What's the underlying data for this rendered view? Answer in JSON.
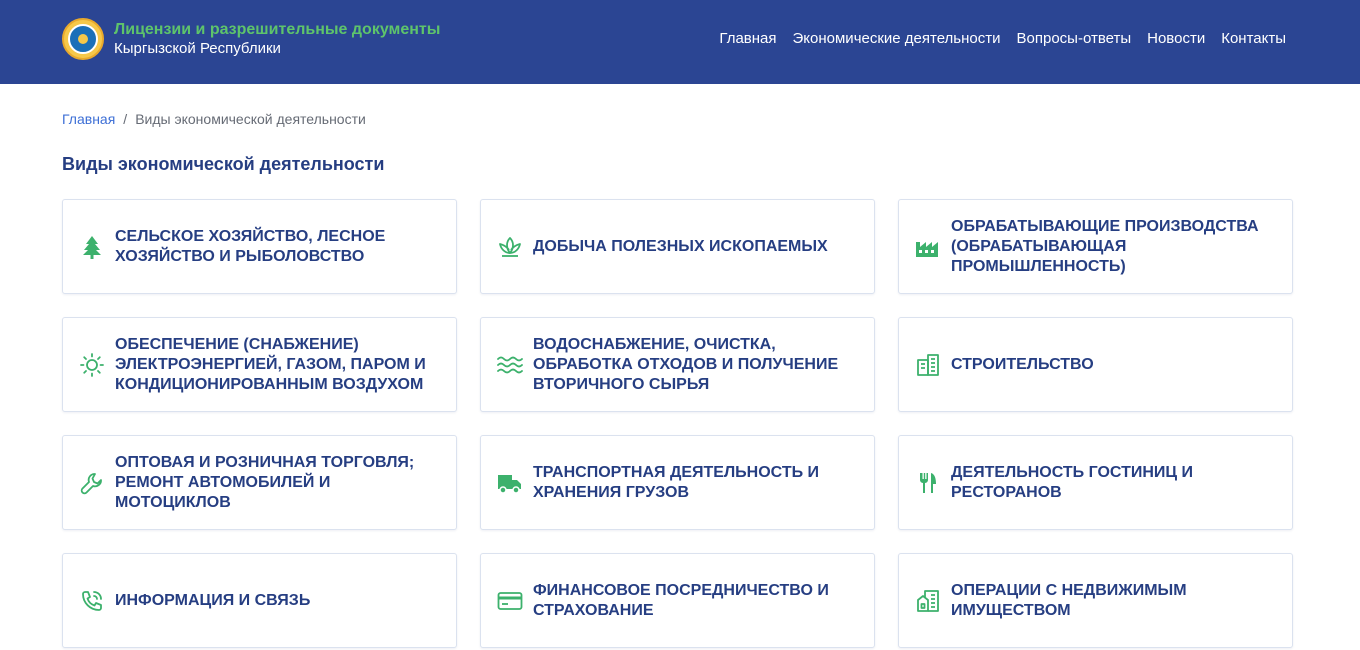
{
  "header": {
    "title_line1": "Лицензии и разрешительные документы",
    "title_line2": "Кыргызской Республики",
    "emblem_icon": "kyrgyz-emblem-icon",
    "nav": [
      {
        "label": "Главная"
      },
      {
        "label": "Экономические деятельности"
      },
      {
        "label": "Вопросы-ответы"
      },
      {
        "label": "Новости"
      },
      {
        "label": "Контакты"
      }
    ]
  },
  "breadcrumb": {
    "home": "Главная",
    "separator": "/",
    "current": "Виды экономической деятельности"
  },
  "page_title": "Виды экономической деятельности",
  "colors": {
    "header_bg": "#2b4593",
    "brand_green": "#5ec46b",
    "heading_navy": "#263e82",
    "icon_green": "#3cb16c",
    "link_blue": "#3d6fd6"
  },
  "categories": [
    {
      "label": "СЕЛЬСКОЕ ХОЗЯЙСТВО, ЛЕСНОЕ ХОЗЯЙСТВО И РЫБОЛОВСТВО",
      "icon": "tree-icon"
    },
    {
      "label": "ДОБЫЧА ПОЛЕЗНЫХ ИСКОПАЕМЫХ",
      "icon": "lotus-icon"
    },
    {
      "label": "ОБРАБАТЫВАЮЩИЕ ПРОИЗВОДСТВА (ОБРАБАТЫВАЮЩАЯ ПРОМЫШЛЕННОСТЬ)",
      "icon": "factory-icon"
    },
    {
      "label": "ОБЕСПЕЧЕНИЕ (СНАБЖЕНИЕ) ЭЛЕКТРОЭНЕРГИЕЙ, ГАЗОМ, ПАРОМ И КОНДИЦИОНИРОВАННЫМ ВОЗДУХОМ",
      "icon": "sun-icon"
    },
    {
      "label": "ВОДОСНАБЖЕНИЕ, ОЧИСТКА, ОБРАБОТКА ОТХОДОВ И ПОЛУЧЕНИЕ ВТОРИЧНОГО СЫРЬЯ",
      "icon": "waves-icon"
    },
    {
      "label": "СТРОИТЕЛЬСТВО",
      "icon": "building-icon"
    },
    {
      "label": "ОПТОВАЯ И РОЗНИЧНАЯ ТОРГОВЛЯ; РЕМОНТ АВТОМОБИЛЕЙ И МОТОЦИКЛОВ",
      "icon": "wrench-icon"
    },
    {
      "label": "ТРАНСПОРТНАЯ ДЕЯТЕЛЬНОСТЬ И ХРАНЕНИЯ ГРУЗОВ",
      "icon": "truck-icon"
    },
    {
      "label": "ДЕЯТЕЛЬНОСТЬ ГОСТИНИЦ И РЕСТОРАНОВ",
      "icon": "fork-knife-icon"
    },
    {
      "label": "ИНФОРМАЦИЯ И СВЯЗЬ",
      "icon": "phone-ringing-icon"
    },
    {
      "label": "ФИНАНСОВОЕ ПОСРЕДНИЧЕСТВО И СТРАХОВАНИЕ",
      "icon": "credit-card-icon"
    },
    {
      "label": "ОПЕРАЦИИ С НЕДВИЖИМЫМ ИМУЩЕСТВОМ",
      "icon": "real-estate-icon"
    }
  ]
}
